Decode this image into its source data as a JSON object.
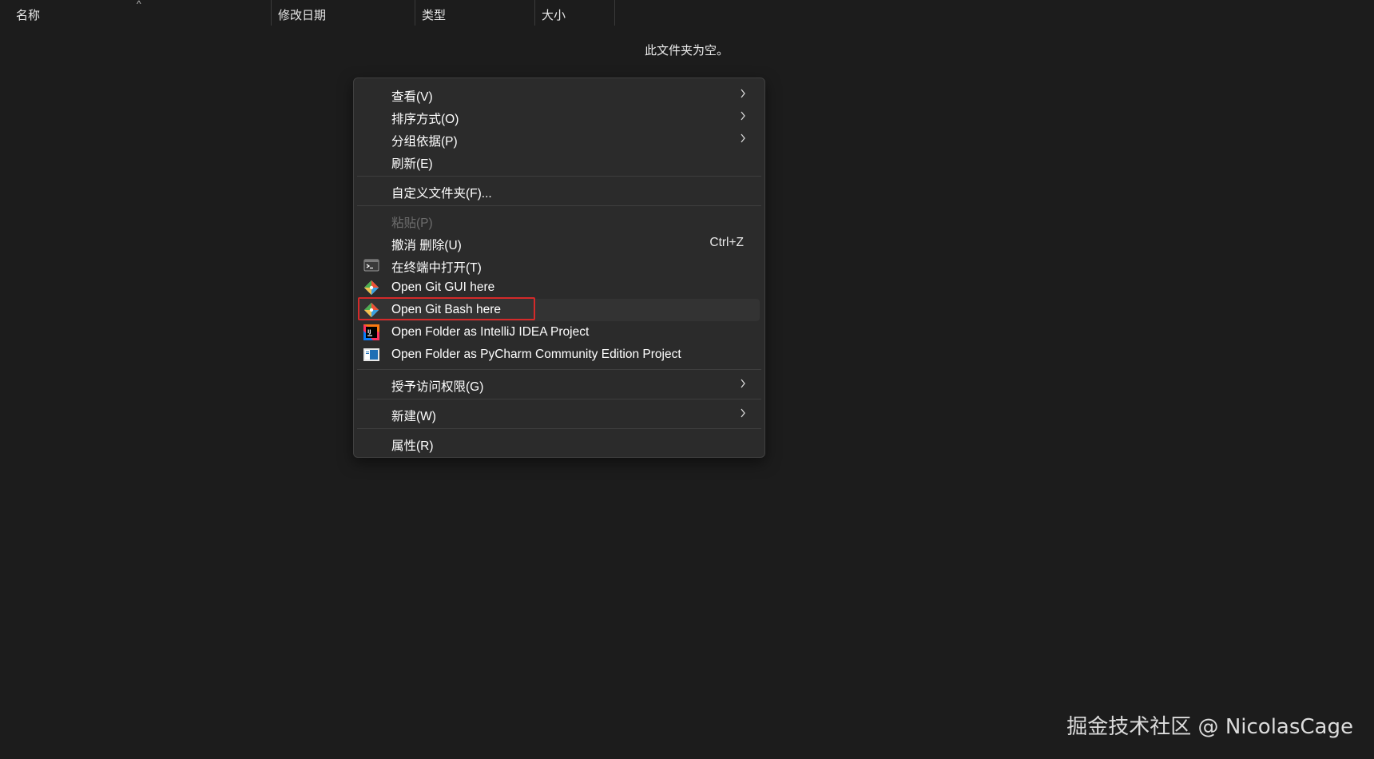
{
  "columns": {
    "name": "名称",
    "modified": "修改日期",
    "type": "类型",
    "size": "大小",
    "sort_caret": "^"
  },
  "empty_message": "此文件夹为空。",
  "menu": {
    "view": "查看(V)",
    "sort_by": "排序方式(O)",
    "group_by": "分组依据(P)",
    "refresh": "刷新(E)",
    "customize_folder": "自定义文件夹(F)...",
    "paste": "粘贴(P)",
    "undo_delete": "撤消 删除(U)",
    "undo_shortcut": "Ctrl+Z",
    "open_in_terminal": "在终端中打开(T)",
    "open_git_gui": "Open Git GUI here",
    "open_git_bash": "Open Git Bash here",
    "open_intellij": "Open Folder as IntelliJ IDEA Project",
    "open_pycharm": "Open Folder as PyCharm Community Edition Project",
    "give_access": "授予访问权限(G)",
    "new": "新建(W)",
    "properties": "属性(R)"
  },
  "icons": {
    "terminal": "terminal-icon",
    "git": "git-icon",
    "intellij": "intellij-icon",
    "pycharm": "pycharm-icon",
    "chevron": "chevron-right-icon"
  },
  "colors": {
    "highlight_box": "#d42a2a",
    "menu_bg": "#2b2b2b",
    "page_bg": "#1c1c1c"
  },
  "watermark": "掘金技术社区 @ NicolasCage"
}
